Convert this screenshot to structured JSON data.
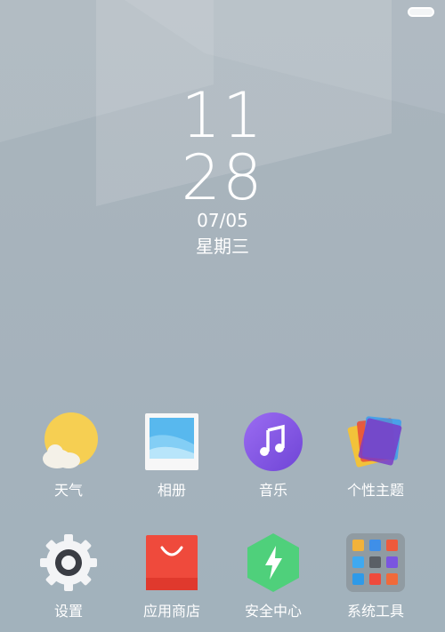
{
  "status_bar": {
    "battery_icon": "battery-icon"
  },
  "lockscreen": {
    "hour": "11",
    "minute": "28",
    "date": "07/05",
    "weekday": "星期三"
  },
  "apps": {
    "row1": [
      {
        "label": "天气",
        "icon": "weather-icon"
      },
      {
        "label": "相册",
        "icon": "gallery-icon"
      },
      {
        "label": "音乐",
        "icon": "music-icon"
      },
      {
        "label": "个性主题",
        "icon": "themes-icon"
      }
    ],
    "row2": [
      {
        "label": "设置",
        "icon": "settings-icon"
      },
      {
        "label": "应用商店",
        "icon": "app-store-icon"
      },
      {
        "label": "安全中心",
        "icon": "security-icon"
      },
      {
        "label": "系统工具",
        "icon": "tools-folder-icon"
      }
    ]
  },
  "colors": {
    "background": "#a7b3bc",
    "text": "#ffffff"
  }
}
